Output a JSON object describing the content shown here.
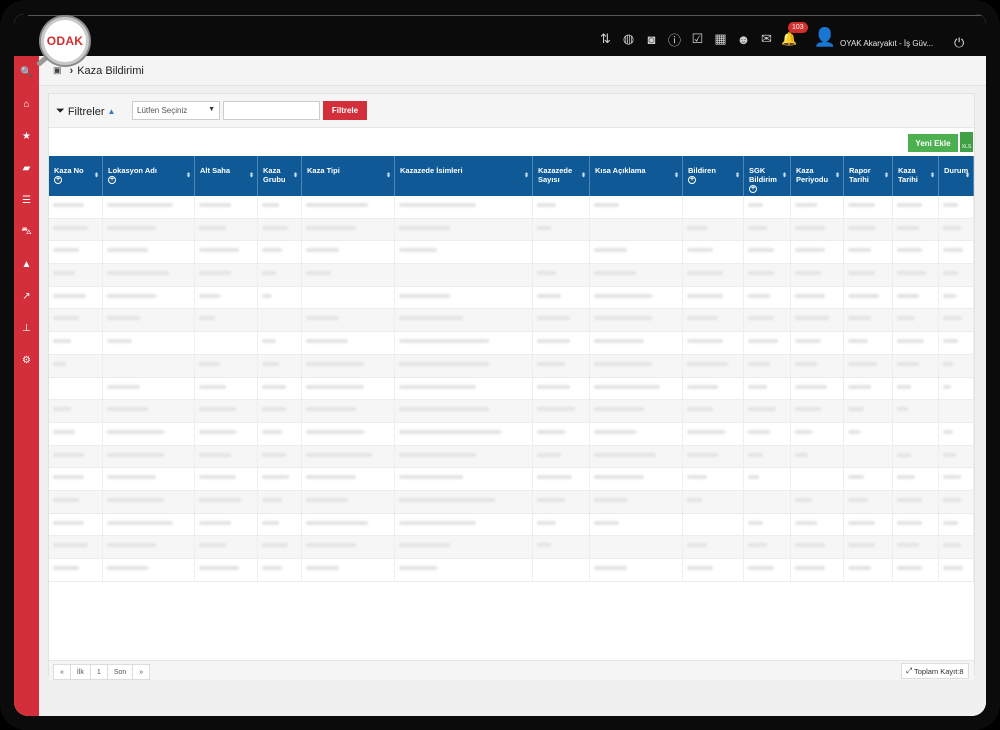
{
  "brand": {
    "logo_text": "ODAK"
  },
  "header": {
    "notification_count": "103",
    "user_name": "OYAK Akaryakıt - İş Güv...",
    "icons": [
      "sort-az-icon",
      "globe-icon",
      "camera-icon",
      "info-icon",
      "calendar-check-icon",
      "calendar-icon",
      "users-icon",
      "mail-icon",
      "bell-icon"
    ]
  },
  "sidebar": {
    "items": [
      "search-icon",
      "home-icon",
      "star-icon",
      "book-icon",
      "list-icon",
      "car-icon",
      "warning-icon",
      "chart-icon",
      "sitemap-icon",
      "settings-icon"
    ]
  },
  "breadcrumb": {
    "title": "Kaza Bildirimi"
  },
  "filter": {
    "label": "Filtreler",
    "select_placeholder": "Lütfen Seçiniz",
    "search_value": "",
    "button_label": "Filtrele"
  },
  "actions": {
    "add_label": "Yeni Ekle",
    "export_label": "XLS"
  },
  "table": {
    "columns": [
      {
        "label": "Kaza No",
        "plus": true
      },
      {
        "label": "Lokasyon Adı",
        "plus": true
      },
      {
        "label": "Alt Saha",
        "plus": false
      },
      {
        "label": "Kaza Grubu",
        "plus": false
      },
      {
        "label": "Kaza Tipi",
        "plus": false
      },
      {
        "label": "Kazazede İsimleri",
        "plus": false
      },
      {
        "label": "Kazazede Sayısı",
        "plus": false
      },
      {
        "label": "Kısa Açıklama",
        "plus": false
      },
      {
        "label": "Bildiren",
        "plus": true
      },
      {
        "label": "SGK Bildirim",
        "plus": true
      },
      {
        "label": "Kaza Periyodu",
        "plus": false
      },
      {
        "label": "Rapor Tarihi",
        "plus": false
      },
      {
        "label": "Kaza Tarihi",
        "plus": false
      },
      {
        "label": "Durum",
        "plus": false
      }
    ],
    "row_count": 17
  },
  "pager": {
    "first": "«",
    "prev": "İlk",
    "page": "1",
    "next": "Son",
    "last": "»",
    "total_label": "Toplam Kayıt:8"
  }
}
